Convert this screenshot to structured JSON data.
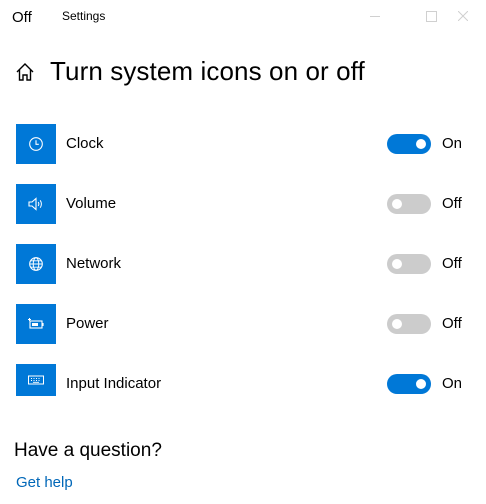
{
  "window": {
    "overlay_label": "Off",
    "title": "Settings"
  },
  "header": {
    "title": "Turn system icons on or off",
    "home_icon": "home-icon"
  },
  "items": [
    {
      "label": "Clock",
      "icon": "clock-icon",
      "state": "On",
      "on": true
    },
    {
      "label": "Volume",
      "icon": "speaker-icon",
      "state": "Off",
      "on": false
    },
    {
      "label": "Network",
      "icon": "globe-icon",
      "state": "Off",
      "on": false
    },
    {
      "label": "Power",
      "icon": "battery-icon",
      "state": "Off",
      "on": false
    },
    {
      "label": "Input Indicator",
      "icon": "keyboard-icon",
      "state": "On",
      "on": true
    }
  ],
  "help": {
    "heading": "Have a question?",
    "link": "Get help"
  },
  "colors": {
    "accent": "#0078d7",
    "toggle_off": "#cccccc",
    "link": "#0067b8"
  }
}
